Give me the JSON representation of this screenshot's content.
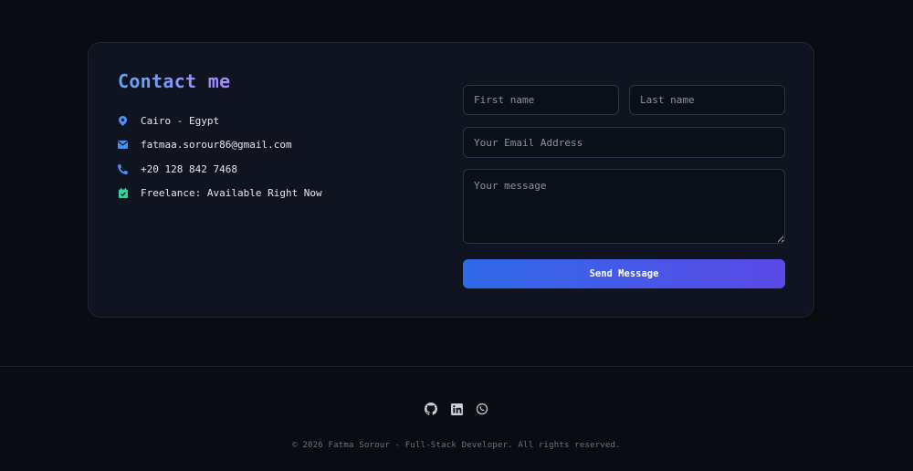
{
  "contact": {
    "title": "Contact me",
    "items": [
      {
        "icon": "location-pin-icon",
        "text": "Cairo - Egypt"
      },
      {
        "icon": "envelope-icon",
        "text": "fatmaa.sorour86@gmail.com"
      },
      {
        "icon": "phone-icon",
        "text": "+20 128 842 7468"
      },
      {
        "icon": "calendar-check-icon",
        "text": "Freelance: Available Right Now"
      }
    ]
  },
  "form": {
    "first_name_placeholder": "First name",
    "last_name_placeholder": "Last name",
    "email_placeholder": "Your Email Address",
    "message_placeholder": "Your message",
    "submit_label": "Send Message"
  },
  "footer": {
    "social_icons": [
      "github-icon",
      "linkedin-icon",
      "whatsapp-icon"
    ],
    "copyright": "© 2026 Fatma Sorour - Full-Stack Developer. All rights reserved."
  },
  "colors": {
    "background": "#0a0c12",
    "card": "#0f1420",
    "accent_blue": "#4b8ff0",
    "accent_green": "#34d399",
    "button_gradient_start": "#2f6ae8",
    "button_gradient_end": "#5b4ae6"
  }
}
